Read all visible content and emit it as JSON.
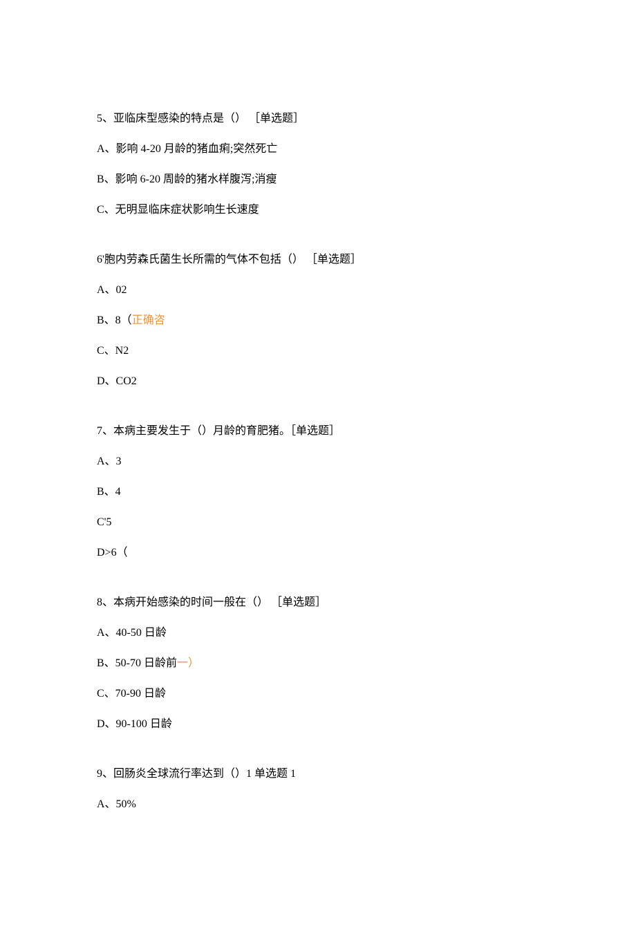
{
  "questions": [
    {
      "stem": "5、亚临床型感染的特点是（） ［单选题］",
      "options": [
        {
          "text": "A、影响 4-20 月龄的猪血痢;突然死亡"
        },
        {
          "text": "B、影响 6-20 周龄的猪水样腹泻;消瘦"
        },
        {
          "text": "C、无明显临床症状影响生长速度"
        }
      ]
    },
    {
      "stem": "6'胞内劳森氏菌生长所需的气体不包括（） ［单选题］",
      "options": [
        {
          "text": "A、02"
        },
        {
          "prefix": "B、8（",
          "highlight": "正确咨"
        },
        {
          "text": "C、N2"
        },
        {
          "text": "D、CO2"
        }
      ]
    },
    {
      "stem": "7、本病主要发生于（）月龄的育肥猪。［单选题］",
      "options": [
        {
          "text": "A、3"
        },
        {
          "text": "B、4"
        },
        {
          "text": "C'5"
        },
        {
          "text": "D>6（"
        }
      ]
    },
    {
      "stem": "8、本病开始感染的时间一般在（） ［单选题］",
      "options": [
        {
          "text": "A、40-50 日龄"
        },
        {
          "prefix": "B、50-70 日龄前",
          "highlight": "一）"
        },
        {
          "text": "C、70-90 日龄"
        },
        {
          "text": "D、90-100 日龄"
        }
      ]
    },
    {
      "stem": "9、回肠炎全球流行率达到（）1 单选题 1",
      "options": [
        {
          "text": "A、50%"
        }
      ]
    }
  ]
}
